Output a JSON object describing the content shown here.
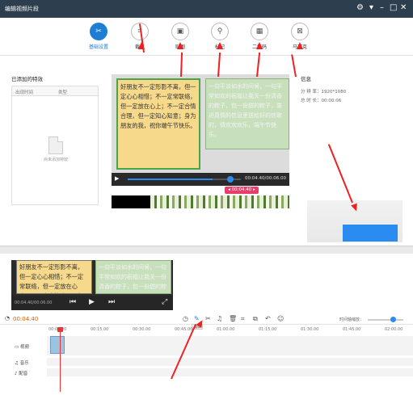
{
  "window": {
    "title": "编辑视频片段"
  },
  "toolbar": {
    "items": [
      {
        "label": "基础设置",
        "icon": "settings-icon",
        "active": true
      },
      {
        "label": "裁剪",
        "icon": "crop-icon",
        "active": false
      },
      {
        "label": "贴图",
        "icon": "image-icon",
        "active": false
      },
      {
        "label": "标记",
        "icon": "marker-icon",
        "active": false
      },
      {
        "label": "二维码",
        "icon": "qrcode-icon",
        "active": false
      },
      {
        "label": "马赛克",
        "icon": "mosaic-icon",
        "active": false
      }
    ]
  },
  "effects_panel": {
    "title": "已添加的特效",
    "col_time": "出现时间",
    "col_type": "类型",
    "empty_text": "尚未添加特效"
  },
  "preview": {
    "card1_text": "好朋友不一定形影不离，但一定心心相惜；不一定常联络，但一定放在心上；不一定合情合理，但一定知心知意；身为朋友的我，祝你端午节快乐。",
    "card2_text": "一句平淡如水的问候，一句平常如欢的祝福让我关一份清香的粽子，包一份甜的粽子，装进真情的信息里送给好的信歌的，情欢欢欢乐，端午节快乐。",
    "time": "00:04.40/00:06.00",
    "marker": "00:04.40"
  },
  "info": {
    "title": "信息",
    "resolution_label": "分 辨 率：",
    "resolution": "1920*1080",
    "duration_label": "总 时 长：",
    "duration": "00:00:06"
  },
  "timeline": {
    "preview_time": "00:04.40/00:06.00",
    "current_time": "00:04.40",
    "tooltip": "编辑",
    "zoom_label": "时间轴缩放：",
    "zoom_level": 0.7,
    "ruler": [
      "00:00.00",
      "00:15.00",
      "00:30.00",
      "00:45.00",
      "01:00.00",
      "01:15.00",
      "01:30.00",
      "01:45.00",
      "02:00.00"
    ],
    "tracks": [
      "视频",
      "音乐",
      "配音"
    ]
  },
  "colors": {
    "accent": "#1e7ed6",
    "arrow": "#f02020",
    "marker": "#e83e6e"
  }
}
